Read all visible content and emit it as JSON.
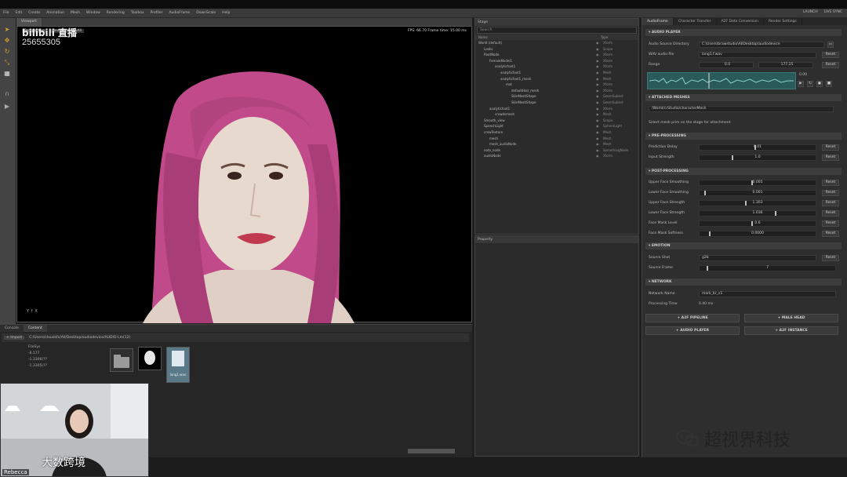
{
  "menu": [
    "File",
    "Edit",
    "Create",
    "Animation",
    "Mesh",
    "Window",
    "Rendering",
    "Toolbox",
    "Profiler",
    "AudioFrame",
    "DownScale",
    "Help"
  ],
  "menu_right": [
    "LAUNCH",
    "LIVE SYNC"
  ],
  "watermark": {
    "platform": "bilibili 直播",
    "room": "25655305"
  },
  "viewport": {
    "tab": "Viewport",
    "controls": [
      "Perspective",
      "Real time",
      "All"
    ],
    "fps": "FPS: 66.70  Frame time: 15.00 ms",
    "axis": "Y ↑ X"
  },
  "outliner": {
    "tab": "Stage",
    "search": "Search",
    "col_name": "Name",
    "col_type": "Type",
    "rows": [
      {
        "d": 0,
        "name": "World (default)",
        "type": "Xform"
      },
      {
        "d": 1,
        "name": "Looks",
        "type": "Scope"
      },
      {
        "d": 1,
        "name": "RootNode",
        "type": "Xform"
      },
      {
        "d": 2,
        "name": "FemaleModel1",
        "type": "Xform"
      },
      {
        "d": 3,
        "name": "analyticfoot1",
        "type": "Xform"
      },
      {
        "d": 4,
        "name": "analyticfoot1",
        "type": "Mesh"
      },
      {
        "d": 4,
        "name": "analyticfoot1_mesh",
        "type": "Mesh"
      },
      {
        "d": 5,
        "name": "mat",
        "type": "Xform"
      },
      {
        "d": 6,
        "name": "defaultHair_mesh",
        "type": "Xform"
      },
      {
        "d": 6,
        "name": "SkinMeshShape",
        "type": "GeomSubset"
      },
      {
        "d": 6,
        "name": "SkinMeshShape",
        "type": "GeomSubset"
      },
      {
        "d": 2,
        "name": "analyticfoot1",
        "type": "Xform"
      },
      {
        "d": 3,
        "name": "crowdsmesh",
        "type": "Mesh"
      },
      {
        "d": 1,
        "name": "Smooth_view",
        "type": "Scope"
      },
      {
        "d": 1,
        "name": "SpeechLight",
        "type": "SphereLight"
      },
      {
        "d": 1,
        "name": "crowTexture",
        "type": "Mesh"
      },
      {
        "d": 2,
        "name": "mesh",
        "type": "Mesh"
      },
      {
        "d": 2,
        "name": "mesh_audioNode",
        "type": "Mesh"
      },
      {
        "d": 1,
        "name": "note_node",
        "type": "SomethingNode"
      },
      {
        "d": 1,
        "name": "audioNode",
        "type": "Xform"
      }
    ]
  },
  "props": {
    "tab": "Property"
  },
  "right": {
    "tabs": [
      "AudioFrame",
      "Character Transfer",
      "A2F Data Conversion",
      "Render Settings"
    ],
    "audio_player": {
      "title": "▾ AUDIO PLAYER",
      "src_label": "Audio Source Directory",
      "src_value": "C:\\Users\\brawstudio\\AllDesktop\\audiodevice",
      "wav_label": "WAV audio file",
      "wav_value": "long1.f.wav",
      "range_label": "Range",
      "range_start": "0.0",
      "range_end": "177.25",
      "reset": "Reset",
      "speed": "0.00"
    },
    "attached": {
      "title": "▾ ATTACHED MESHES",
      "mesh": "/World/crStudio/characterMesh",
      "hint": "Select mesh prim on the stage for attachment"
    },
    "pre": {
      "title": "▾ PRE-PROCESSING",
      "rows": [
        {
          "label": "Prediction Delay",
          "value": "0.01",
          "pos": 0.48
        },
        {
          "label": "Input Strength",
          "value": "1.0",
          "pos": 0.28
        }
      ]
    },
    "post": {
      "title": "▾ POST-PROCESSING",
      "rows": [
        {
          "label": "Upper Face Smoothing",
          "value": "0.005",
          "pos": 0.45
        },
        {
          "label": "Lower Face Smoothing",
          "value": "0.001",
          "pos": 0.04
        },
        {
          "label": "Upper Face Strength",
          "value": "1.303",
          "pos": 0.4
        },
        {
          "label": "Lower Face Strength",
          "value": "1.036",
          "pos": 0.66
        },
        {
          "label": "Face Mask Level",
          "value": "0.6",
          "pos": 0.45
        },
        {
          "label": "Face Mask Softness",
          "value": "0.0000",
          "pos": 0.08
        }
      ]
    },
    "emotion": {
      "title": "▾ EMOTION",
      "source_label": "Source Shot",
      "source_value": "g2b",
      "frame_label": "Source Frame",
      "frame_value": "7"
    },
    "network": {
      "title": "▾ NETWORK",
      "name_label": "Network Name",
      "name_value": "mark_br_v1",
      "time_label": "Processing Time",
      "time_value": "0.40 ms"
    },
    "buttons": [
      "+ A2F PIPELINE",
      "+ MALE HEAD",
      "+ AUDIO PLAYER",
      "+ A2F INSTANCE"
    ]
  },
  "bottom": {
    "tabs": [
      "Console",
      "Content"
    ],
    "path": "C:/Users/cloudsfx/All/Desktop/audiodevice/AUDIO-Lm(12)",
    "import": "+ Import",
    "tree": [
      "FileSys",
      "-8.177",
      "-1.3306(??",
      "-1.3305(??"
    ],
    "files": [
      "",
      "",
      "long1.wav"
    ]
  },
  "camera": {
    "overlay_text": "大数跨境",
    "user": "Rebecca"
  },
  "wechat": {
    "name": "超视界科技"
  }
}
